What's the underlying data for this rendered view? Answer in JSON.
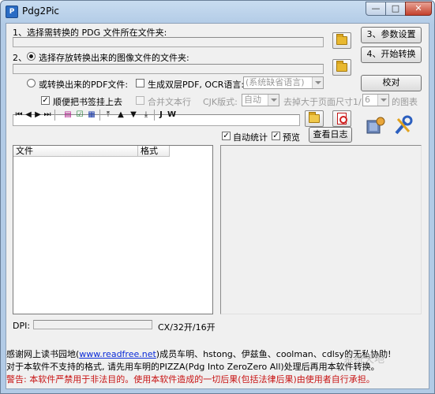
{
  "window": {
    "title": "Pdg2Pic",
    "min_label": "—",
    "max_label": "□",
    "close_label": "✕"
  },
  "steps": {
    "step1_label": "1、选择需转换的 PDG 文件所在文件夹:",
    "step2_label": "2、",
    "step2_radio_label": "选择存放转换出来的图像文件的文件夹:",
    "pdf_radio_label": "或转换出来的PDF文件:"
  },
  "buttons": {
    "params": "3、参数设置",
    "start": "4、开始转换",
    "proofread": "校对",
    "view_log": "查看日志"
  },
  "options": {
    "bookmark_label": "顺便把书签挂上去",
    "double_layer_label": "生成双层PDF, OCR语言:",
    "ocr_language": "(系统缺省语言)",
    "merge_text_label": "合并文本行",
    "cjk_label": "CJK版式:",
    "cjk_value": "自动",
    "remove_label": "去掉大于页面尺寸1/",
    "remove_value": "6",
    "remove_suffix": "的图表",
    "auto_stat_label": "自动统计",
    "preview_label": "预览"
  },
  "toolbar": {
    "icons": [
      "first-icon",
      "prev-icon",
      "next-icon",
      "last-icon",
      "doc-icon",
      "check-doc-icon",
      "save-doc-icon",
      "move-top-icon",
      "move-up-icon",
      "move-down-icon",
      "move-bottom-icon",
      "j-icon",
      "w-icon"
    ]
  },
  "file_list": {
    "col_file": "文件",
    "col_format": "格式"
  },
  "status": {
    "dpi_label": "DPI:",
    "size_text": "CX/32开/16开"
  },
  "footer": {
    "line1_prefix": "感谢网上读书园地(",
    "line1_link": "www.readfree.net",
    "line1_suffix": ")成员车明、hstong、伊兹鱼、coolman、cdlsy的无私协助!",
    "line2": "对于本软件不支持的格式, 请先用车明的PIZZA(Pdg Into ZeroZero All)处理后再用本软件转换。",
    "line3": "警告: 本软件严禁用于非法目的。使用本软件造成的一切后果(包括法律后果)由使用者自行承担。"
  },
  "watermark": "系统天地",
  "colors": {
    "warning": "#c81414",
    "link": "#0a2bd8",
    "title_bar": "#b2cbe6"
  }
}
